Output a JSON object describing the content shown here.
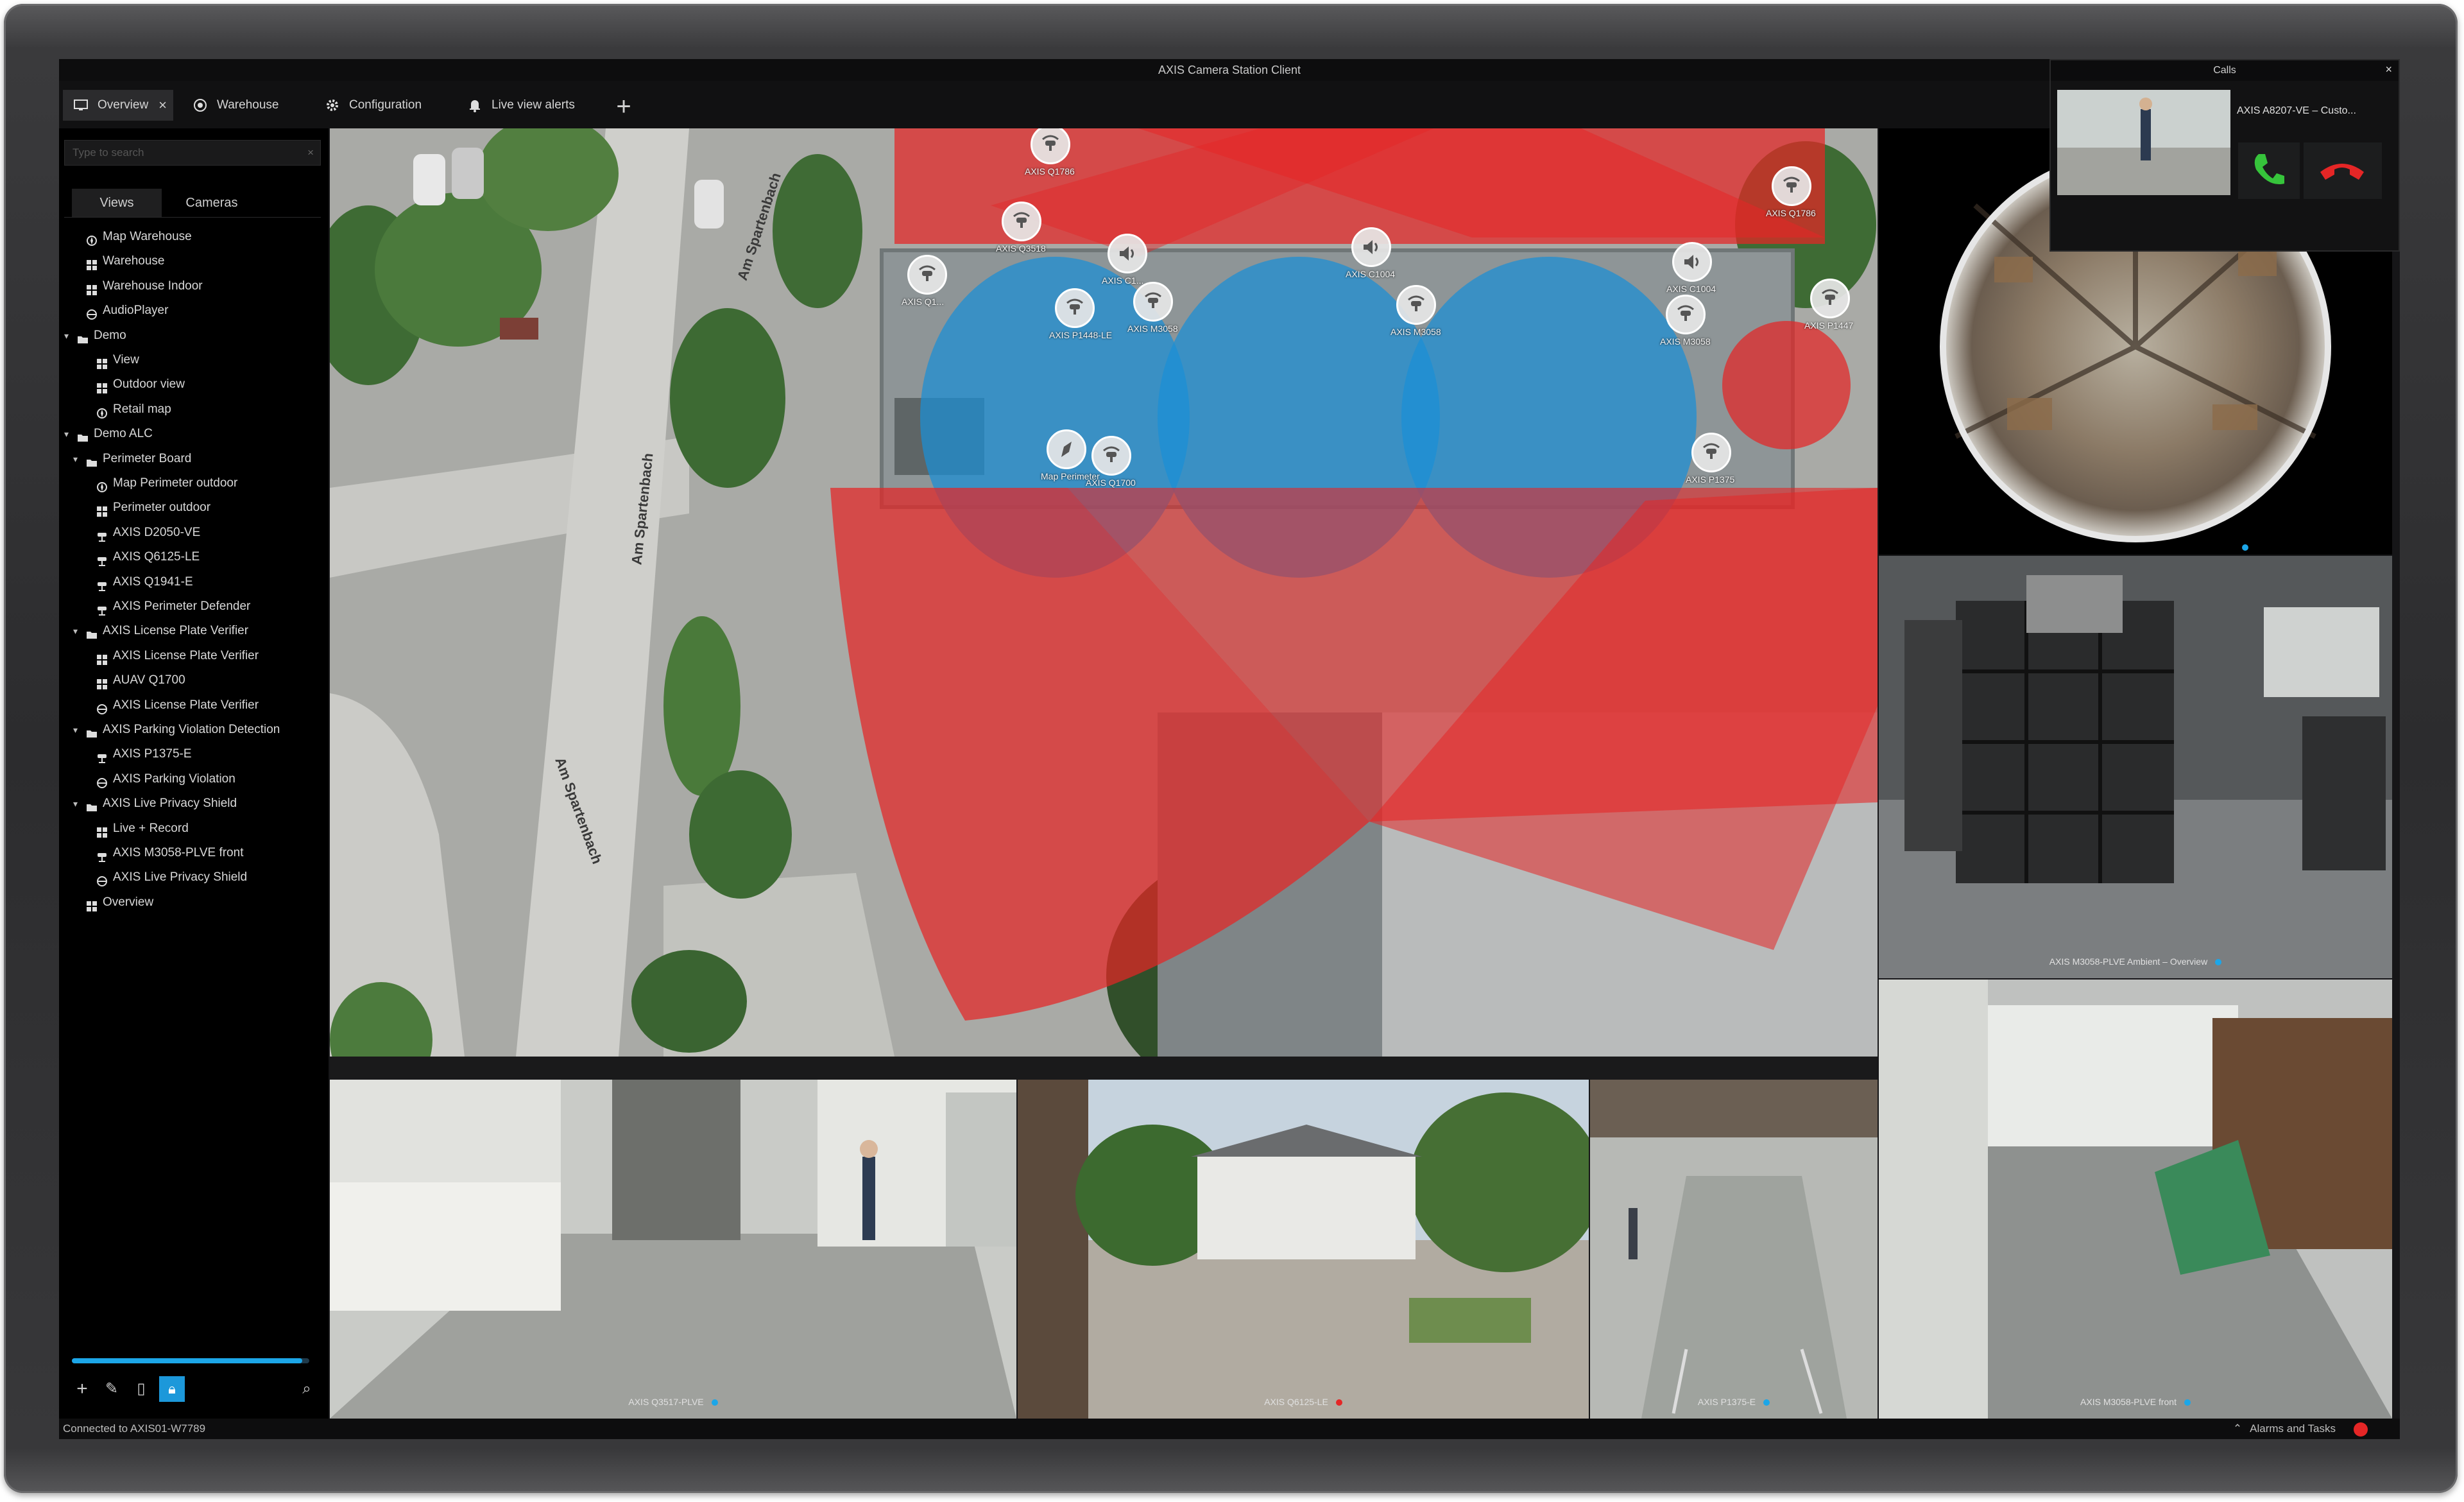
{
  "app": {
    "title": "AXIS Camera Station Client"
  },
  "tabs": [
    {
      "label": "Overview",
      "icon": "monitor-icon"
    },
    {
      "label": "Warehouse",
      "icon": "camera-icon"
    },
    {
      "label": "Configuration",
      "icon": "gear-icon"
    },
    {
      "label": "Live view alerts",
      "icon": "bell-icon"
    }
  ],
  "sidebar": {
    "search_placeholder": "Type to search",
    "subtabs": [
      "Views",
      "Cameras"
    ],
    "tree": [
      {
        "label": "Map Warehouse",
        "level": 1,
        "icon": "map-icon"
      },
      {
        "label": "Warehouse",
        "level": 1,
        "icon": "grid-icon"
      },
      {
        "label": "Warehouse Indoor",
        "level": 1,
        "icon": "grid-icon"
      },
      {
        "label": "AudioPlayer",
        "level": 1,
        "icon": "globe-icon"
      },
      {
        "label": "Demo",
        "level": 0,
        "icon": "folder-icon"
      },
      {
        "label": "View",
        "level": 2,
        "icon": "grid-icon"
      },
      {
        "label": "Outdoor view",
        "level": 2,
        "icon": "grid-icon"
      },
      {
        "label": "Retail map",
        "level": 2,
        "icon": "map-icon"
      },
      {
        "label": "Demo ALC",
        "level": 0,
        "icon": "folder-icon"
      },
      {
        "label": "Perimeter Board",
        "level": 1,
        "icon": "folder-icon"
      },
      {
        "label": "Map Perimeter outdoor",
        "level": 2,
        "icon": "map-icon"
      },
      {
        "label": "Perimeter outdoor",
        "level": 2,
        "icon": "grid-icon"
      },
      {
        "label": "AXIS D2050-VE",
        "level": 2,
        "icon": "camera-icon"
      },
      {
        "label": "AXIS Q6125-LE",
        "level": 2,
        "icon": "camera-icon"
      },
      {
        "label": "AXIS Q1941-E",
        "level": 2,
        "icon": "camera-icon"
      },
      {
        "label": "AXIS Perimeter Defender",
        "level": 2,
        "icon": "camera-icon"
      },
      {
        "label": "AXIS License Plate Verifier",
        "level": 1,
        "icon": "folder-icon"
      },
      {
        "label": "AXIS License Plate Verifier",
        "level": 2,
        "icon": "grid-icon"
      },
      {
        "label": "AUAV Q1700",
        "level": 2,
        "icon": "grid-icon"
      },
      {
        "label": "AXIS License Plate Verifier",
        "level": 2,
        "icon": "globe-icon"
      },
      {
        "label": "AXIS Parking Violation Detection",
        "level": 1,
        "icon": "folder-icon"
      },
      {
        "label": "AXIS P1375-E",
        "level": 2,
        "icon": "camera-icon"
      },
      {
        "label": "AXIS Parking Violation",
        "level": 2,
        "icon": "globe-icon"
      },
      {
        "label": "AXIS Live Privacy Shield",
        "level": 1,
        "icon": "folder-icon"
      },
      {
        "label": "Live + Record",
        "level": 2,
        "icon": "grid-icon"
      },
      {
        "label": "AXIS M3058-PLVE front",
        "level": 2,
        "icon": "camera-icon"
      },
      {
        "label": "AXIS Live Privacy Shield",
        "level": 2,
        "icon": "globe-icon"
      },
      {
        "label": "Overview",
        "level": 1,
        "icon": "grid-icon"
      }
    ],
    "scroll_fraction": 0.97
  },
  "map": {
    "roads": [
      "Am Spartenbach",
      "Am Spartenbach",
      "Am Spartenbach"
    ],
    "pins": [
      {
        "label": "AXIS Q1786",
        "icon": "camera-icon"
      },
      {
        "label": "AXIS Q3518",
        "icon": "camera-icon"
      },
      {
        "label": "AXIS Q1...",
        "icon": "camera-icon"
      },
      {
        "label": "AXIS C1...",
        "icon": "speaker-icon"
      },
      {
        "label": "AXIS P1448-LE",
        "icon": "camera-icon"
      },
      {
        "label": "AXIS M3058",
        "icon": "camera-icon"
      },
      {
        "label": "AXIS C1004",
        "icon": "speaker-icon"
      },
      {
        "label": "AXIS M3058",
        "icon": "camera-icon"
      },
      {
        "label": "AXIS C1004",
        "icon": "speaker-icon"
      },
      {
        "label": "AXIS M3058",
        "icon": "camera-icon"
      },
      {
        "label": "AXIS Q1786",
        "icon": "camera-icon"
      },
      {
        "label": "AXIS P1447",
        "icon": "camera-icon"
      },
      {
        "label": "Map Perimeter",
        "icon": "compass-icon"
      },
      {
        "label": "AXIS Q1700",
        "icon": "camera-icon"
      },
      {
        "label": "AXIS P1375",
        "icon": "camera-icon"
      }
    ]
  },
  "cameras": [
    {
      "label": "AXIS Q3517-PLVE",
      "status": "blue"
    },
    {
      "label": "AXIS M3058-PLVE Ambient – Overview",
      "status": "blue"
    },
    {
      "label": "AXIS Q3517-PLVE",
      "status": "blue"
    },
    {
      "label": "AXIS Q6125-LE",
      "status": "red"
    },
    {
      "label": "AXIS P1375-E",
      "status": "blue"
    },
    {
      "label": "AXIS M3058-PLVE front",
      "status": "blue"
    }
  ],
  "calls": {
    "title": "Calls",
    "caller": "AXIS A8207-VE – Custo..."
  },
  "status": {
    "connection": "Connected to AXIS01-W7789",
    "alarms": "Alarms and Tasks"
  },
  "colors": {
    "accent": "#1ca6e8",
    "zone_red": "#e52626",
    "zone_blue": "#1a8fd6",
    "answer": "#36c43b",
    "hangup": "#e52626"
  }
}
